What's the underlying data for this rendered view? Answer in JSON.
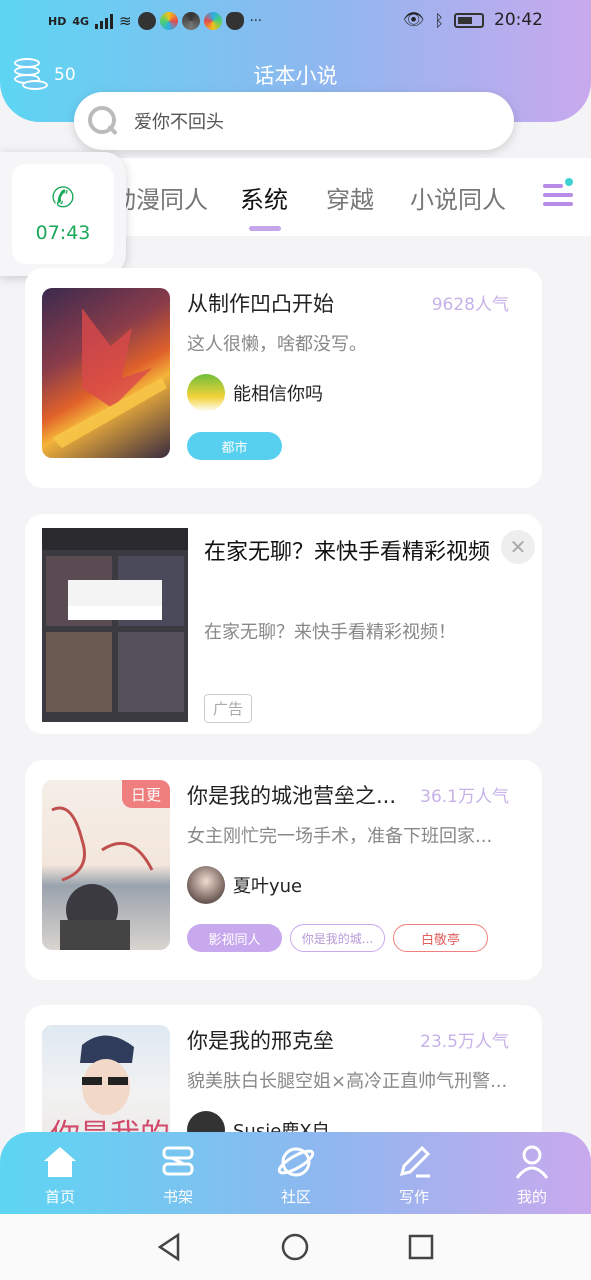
{
  "status_bar": {
    "network": "4G",
    "hd": "HD",
    "time": "20:42",
    "more": "···"
  },
  "header": {
    "coins": "50",
    "app_title": "话本小说"
  },
  "search": {
    "placeholder": "爱你不回头"
  },
  "tabs": [
    {
      "label": "动漫同人"
    },
    {
      "label": "系统",
      "active": true
    },
    {
      "label": "穿越"
    },
    {
      "label": "小说同人"
    }
  ],
  "call_float": {
    "time": "07:43"
  },
  "books": [
    {
      "title": "从制作凹凸开始",
      "popularity": "9628人气",
      "desc": "这人很懒，啥都没写。",
      "author": "能相信你吗",
      "tags": [
        {
          "label": "都市",
          "style": "filled-cyan"
        }
      ]
    },
    {
      "title": "你是我的城池营垒之...",
      "popularity": "36.1万人气",
      "desc": "女主刚忙完一场手术，准备下班回家...",
      "author": "夏叶yue",
      "badge": "日更",
      "tags": [
        {
          "label": "影视同人",
          "style": "filled-purple"
        },
        {
          "label": "你是我的城...",
          "style": "outline-purple"
        },
        {
          "label": "白敬亭",
          "style": "outline-red"
        }
      ]
    },
    {
      "title": "你是我的邢克垒",
      "popularity": "23.5万人气",
      "desc": "貌美肤白长腿空姐×高冷正直帅气刑警...",
      "author": "Susie鹿X自"
    }
  ],
  "ad": {
    "title": "在家无聊？来快手看精彩视频",
    "desc": "在家无聊？来快手看精彩视频！",
    "label": "广告",
    "close": "✕"
  },
  "bottom_nav": [
    {
      "label": "首页",
      "icon": "home-icon"
    },
    {
      "label": "书架",
      "icon": "bookshelf-icon"
    },
    {
      "label": "社区",
      "icon": "planet-icon"
    },
    {
      "label": "写作",
      "icon": "pen-icon"
    },
    {
      "label": "我的",
      "icon": "user-icon"
    }
  ],
  "colors": {
    "accent_purple": "#c6a6ea",
    "accent_cyan": "#5dd5f3",
    "call_green": "#1aa85a",
    "update_red": "#ef7f7f"
  }
}
